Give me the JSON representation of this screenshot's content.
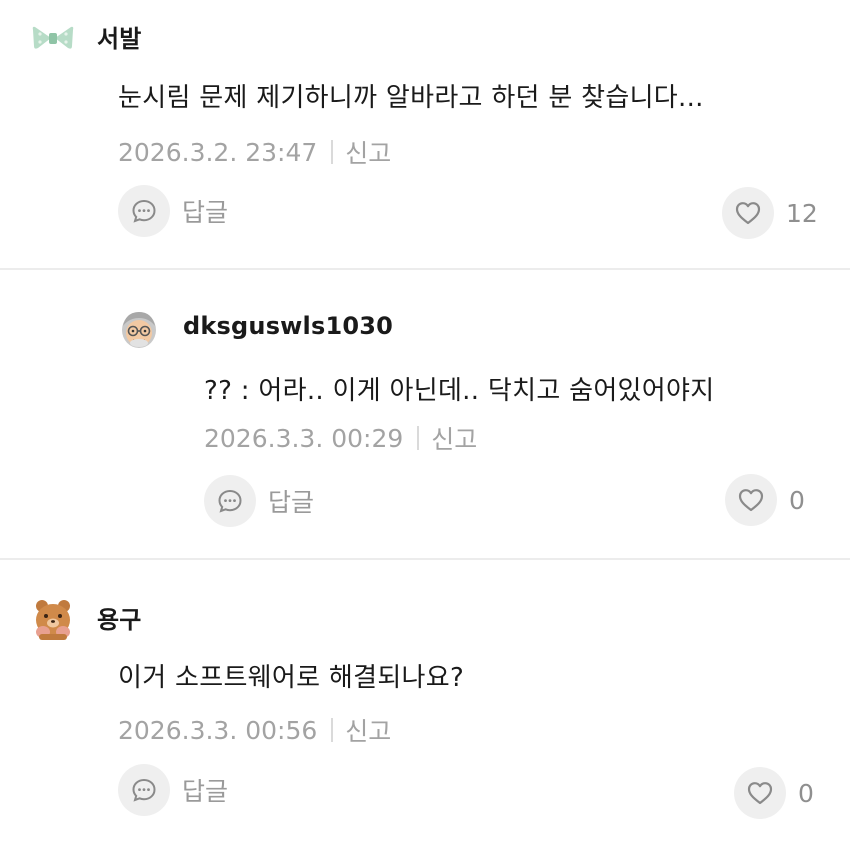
{
  "comments": [
    {
      "nickname": "서발",
      "avatar_icon": "ribbon-bow-icon",
      "text": "눈시림 문제 제기하니까 알바라고 하던 분 찾습니다...",
      "timestamp": "2026.3.2. 23:47",
      "report_label": "신고",
      "reply_label": "답글",
      "like_count": "12",
      "is_reply": false
    },
    {
      "nickname": "dksguswls1030",
      "avatar_icon": "old-man-avatar-icon",
      "text": "?? : 어라.. 이게 아닌데.. 닥치고 숨어있어야지",
      "timestamp": "2026.3.3. 00:29",
      "report_label": "신고",
      "reply_label": "답글",
      "like_count": "0",
      "is_reply": true
    },
    {
      "nickname": "용구",
      "avatar_icon": "bear-avatar-icon",
      "text": "이거 소프트웨어로 해결되나요?",
      "timestamp": "2026.3.3. 00:56",
      "report_label": "신고",
      "reply_label": "답글",
      "like_count": "0",
      "is_reply": false
    }
  ],
  "colors": {
    "text": "#1a1a1a",
    "meta": "#a3a3a3",
    "button_bg": "#efefef",
    "divider": "#ececec"
  }
}
